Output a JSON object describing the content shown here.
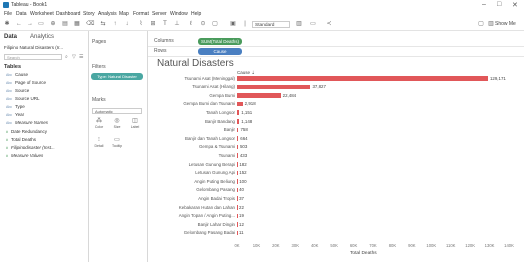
{
  "window": {
    "title": "Tableau - Book1",
    "controls": [
      "–",
      "□",
      "✕"
    ]
  },
  "menu": [
    "File",
    "Data",
    "Worksheet",
    "Dashboard",
    "Story",
    "Analysis",
    "Map",
    "Format",
    "Server",
    "Window",
    "Help"
  ],
  "toolbar": {
    "fit": "Standard",
    "show_me": "Show Me"
  },
  "left_panel": {
    "tab_data": "Data",
    "tab_analytics": "Analytics",
    "datasource": "Filipino Natural Disasters (Ir...",
    "search_placeholder": "Search",
    "tables_header": "Tables",
    "dimensions": [
      "Cause",
      "Page of Source",
      "Source",
      "Source URL",
      "Type",
      "Year",
      "Measure Names"
    ],
    "measures": [
      "Date Redundancy",
      "Total Deaths",
      "Filipinodisaster (Inst...",
      "Measure Values"
    ]
  },
  "cards": {
    "pages": "Pages",
    "filters": "Filters",
    "filter_pill": "Type: Natural Disaster",
    "marks": "Marks",
    "mark_type": "Automatic",
    "mark_buttons": [
      "Color",
      "Size",
      "Label",
      "Detail",
      "Tooltip"
    ]
  },
  "shelves": {
    "columns_label": "Columns",
    "columns_pill": "SUM(Total Deaths)",
    "rows_label": "Rows",
    "rows_pill": "Cause"
  },
  "chart_data": {
    "type": "bar",
    "title": "Natural Disasters",
    "header": "Cause",
    "xlabel": "Total Deaths",
    "xlim": [
      0,
      1400
    ],
    "ticks": [
      "0K",
      "10K",
      "20K",
      "30K",
      "40K",
      "50K",
      "60K",
      "70K",
      "80K",
      "90K",
      "100K",
      "110K",
      "120K",
      "130K",
      "140K"
    ],
    "tick_values": [
      0,
      100,
      200,
      300,
      400,
      500,
      600,
      700,
      800,
      900,
      1000,
      1100,
      1200,
      1300,
      1400
    ],
    "categories": [
      "Tsunami Asat (Meninggal)",
      "Tsunami Asat (Hilang)",
      "Gempa Bumi",
      "Gempa Bumi dan Tsunami",
      "Tanah Longsor",
      "Banjir Bandang",
      "Banjir",
      "Banjir dan Tanah Longsor",
      "Gempa & Tsunami",
      "Tsunami",
      "Letusan Gunung Berapi",
      "Letusan Gunung Api",
      "Angin Puting Beliung",
      "Gelombang Pasang",
      "Angin Badai Tropis",
      "Kebakaran Hutan dan Lahan",
      "Angin Topan / Angin Puting...",
      "Banjir Lahar Dingin",
      "Gelombang Pasang Badai"
    ],
    "values": [
      1291.71,
      378.27,
      224.84,
      29.18,
      11.51,
      11.48,
      7.58,
      6.64,
      5.03,
      4.33,
      1.82,
      1.52,
      1.0,
      0.4,
      0.37,
      0.22,
      0.19,
      0.12,
      0.11
    ],
    "value_labels": [
      "129,171",
      "37,827",
      "22,484",
      "2,918",
      "1,151",
      "1,148",
      "758",
      "664",
      "503",
      "433",
      "182",
      "152",
      "100",
      "40",
      "37",
      "22",
      "19",
      "12",
      "11"
    ]
  }
}
